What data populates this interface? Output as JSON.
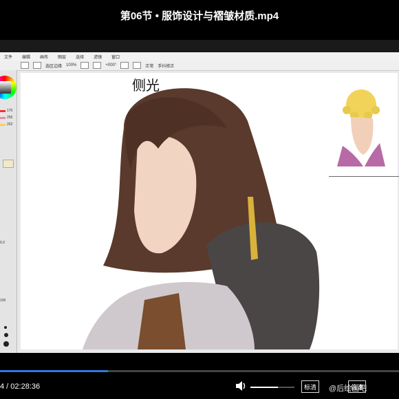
{
  "header": {
    "title": "第06节 • 服饰设计与褶皱材质.mp4"
  },
  "app": {
    "menu": [
      "文件",
      "编辑",
      "画布",
      "图层",
      "选择",
      "滤镜",
      "窗口"
    ],
    "toolbar": {
      "zoom": "100%",
      "rotate": "+000°",
      "stabilizer": "手抖修正",
      "normal": "正常",
      "check_label": "选区边缘"
    },
    "left_panel": {
      "values": [
        "170",
        "255",
        "252"
      ],
      "brush_size": "5.0",
      "density": "100"
    }
  },
  "canvas": {
    "label": "侧光"
  },
  "player": {
    "time": "4 / 02:28:36",
    "progress": 0.27,
    "volume": 0.62,
    "buttons": {
      "definition": "标清",
      "speed": "倍速"
    }
  },
  "watermark": "@后绘画吧",
  "colors": {
    "accent": "#2c7be5",
    "hair": "#5a3a2c",
    "fur": "#4a4646",
    "robe": "#cfc9cd"
  }
}
